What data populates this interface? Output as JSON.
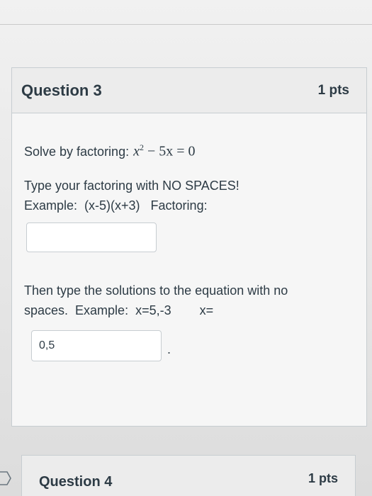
{
  "question": {
    "title": "Question 3",
    "points": "1 pts",
    "prompt_text": "Solve by factoring:",
    "prompt_math": {
      "base": "x",
      "exponent": "2",
      "rest": " − 5x = 0"
    },
    "instructions_1": {
      "line1": "Type your factoring with NO SPACES!",
      "line2": "Example:  (x-5)(x+3)   Factoring:"
    },
    "factoring_input": {
      "value": ""
    },
    "instructions_2": {
      "line1": "Then type the solutions to the equation with no",
      "line2": "spaces.  Example:  x=5,-3        x="
    },
    "solutions_input": {
      "value": "0,5"
    },
    "trailing": "."
  },
  "next_question": {
    "title": "Question 4",
    "points": "1 pts"
  },
  "icons": {
    "flag": "flag-icon"
  },
  "colors": {
    "text": "#2d3b45",
    "border": "#c7cdd1",
    "header_bg": "#ececec",
    "input_bg": "#ffffff"
  }
}
